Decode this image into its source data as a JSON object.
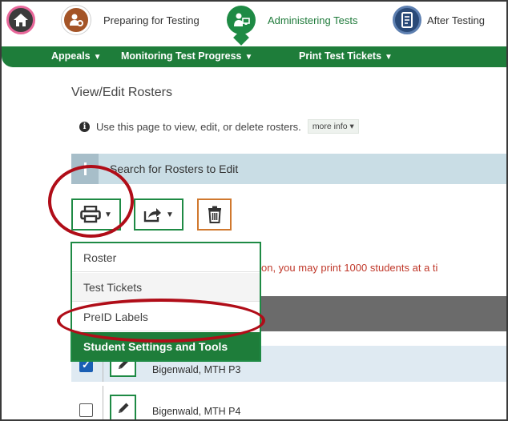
{
  "topnav": {
    "home_icon": "home-icon",
    "steps": [
      {
        "label": "Preparing for Testing",
        "icon": "gear-person-icon",
        "color": "#a45427"
      },
      {
        "label": "Administering Tests",
        "icon": "person-monitor-icon",
        "color": "#1e8a44",
        "active": true
      },
      {
        "label": "After Testing",
        "icon": "document-icon",
        "color": "#2a4a78"
      }
    ]
  },
  "subnav": {
    "items": [
      "Appeals",
      "Monitoring Test Progress",
      "Print Test Tickets"
    ]
  },
  "page": {
    "title": "View/Edit Rosters",
    "info_text": "Use this page to view, edit, or delete rosters.",
    "more_info": "more info",
    "search_panel_label": "Search for Rosters to Edit"
  },
  "toolbar": {
    "print_icon": "printer-icon",
    "export_icon": "share-export-icon",
    "delete_icon": "trash-icon"
  },
  "warning_text": "on, you may print 1000 students at a ti",
  "print_menu": {
    "items": [
      "Roster",
      "Test Tickets",
      "PreID Labels",
      "Student Settings and Tools"
    ]
  },
  "rows": [
    {
      "name": "Bigenwald, MTH P3",
      "checked": true
    },
    {
      "name": "Bigenwald, MTH P4",
      "checked": false
    }
  ],
  "colors": {
    "accent_green": "#1e7d3a",
    "annotation_red": "#b00d18",
    "warning_red": "#c0392b"
  }
}
